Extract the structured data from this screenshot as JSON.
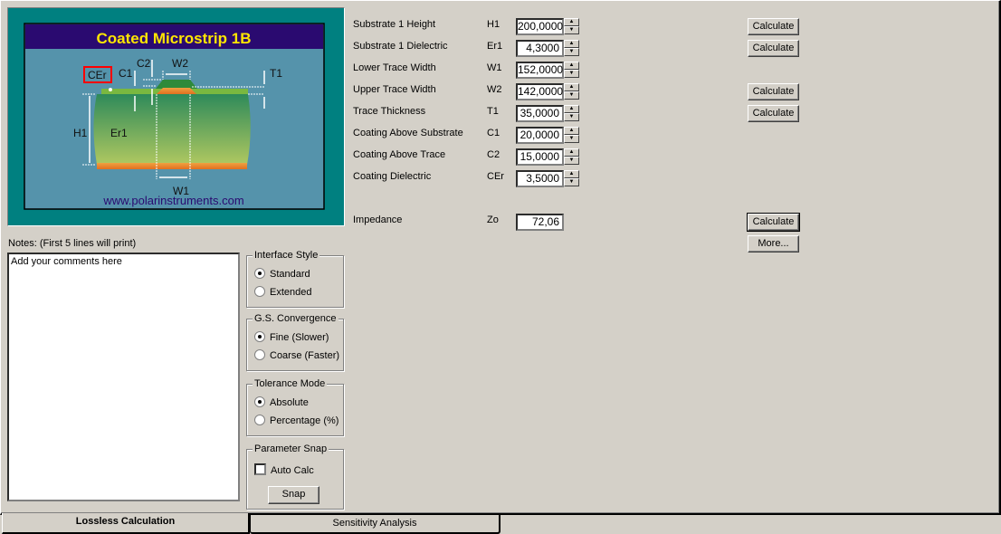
{
  "diagram": {
    "title": "Coated Microstrip 1B",
    "url": "www.polarinstruments.com",
    "labels": {
      "cer": "CEr",
      "c1": "C1",
      "c2": "C2",
      "w2": "W2",
      "t1": "T1",
      "h1": "H1",
      "er1": "Er1",
      "w1": "W1"
    },
    "colors": {
      "frame": "#008080",
      "title_bg": "#2a0a70",
      "title_text": "#ffe600",
      "bg": "#5593ab",
      "highlight": "#ff0000"
    }
  },
  "params": [
    {
      "label": "Substrate 1 Height",
      "symbol": "H1",
      "value": "200,0000",
      "calc": "Calculate"
    },
    {
      "label": "Substrate 1 Dielectric",
      "symbol": "Er1",
      "value": "4,3000",
      "calc": "Calculate"
    },
    {
      "label": "Lower Trace Width",
      "symbol": "W1",
      "value": "152,0000",
      "calc": null
    },
    {
      "label": "Upper Trace Width",
      "symbol": "W2",
      "value": "142,0000",
      "calc": "Calculate"
    },
    {
      "label": "Trace Thickness",
      "symbol": "T1",
      "value": "35,0000",
      "calc": "Calculate"
    },
    {
      "label": "Coating Above Substrate",
      "symbol": "C1",
      "value": "20,0000",
      "calc": null
    },
    {
      "label": "Coating Above Trace",
      "symbol": "C2",
      "value": "15,0000",
      "calc": null
    },
    {
      "label": "Coating Dielectric",
      "symbol": "CEr",
      "value": "3,5000",
      "calc": null
    }
  ],
  "impedance": {
    "label": "Impedance",
    "symbol": "Zo",
    "value": "72,06",
    "calc": "Calculate",
    "more": "More..."
  },
  "notes": {
    "label": "Notes: (First 5 lines will print)",
    "value": "Add your comments here"
  },
  "groups": {
    "interface": {
      "title": "Interface Style",
      "options": [
        "Standard",
        "Extended"
      ],
      "selected": 0
    },
    "convergence": {
      "title": "G.S. Convergence",
      "options": [
        "Fine (Slower)",
        "Coarse (Faster)"
      ],
      "selected": 0
    },
    "tolerance": {
      "title": "Tolerance Mode",
      "options": [
        "Absolute",
        "Percentage (%)"
      ],
      "selected": 0
    },
    "snap": {
      "title": "Parameter Snap",
      "auto_calc": "Auto Calc",
      "auto_calc_checked": false,
      "snap": "Snap"
    }
  },
  "tabs": [
    {
      "label": "Lossless Calculation",
      "active": true
    },
    {
      "label": "Sensitivity Analysis",
      "active": false
    }
  ]
}
